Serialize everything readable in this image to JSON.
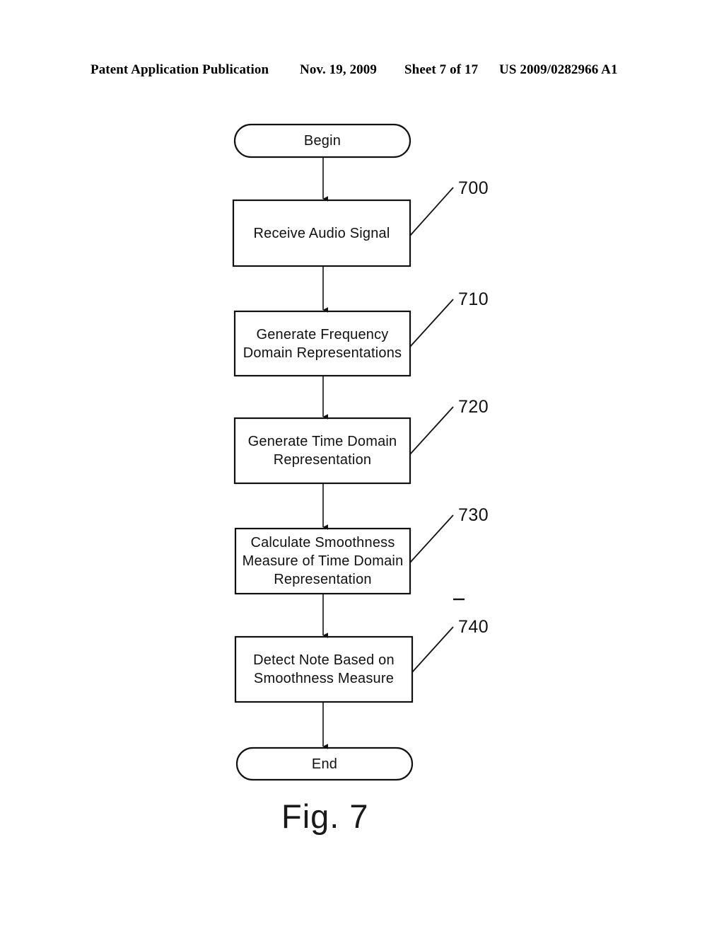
{
  "header": {
    "publication": "Patent Application Publication",
    "date": "Nov. 19, 2009",
    "sheet": "Sheet 7 of 17",
    "document_number": "US 2009/0282966 A1"
  },
  "figure": {
    "caption": "Fig. 7",
    "stroke_color": "#000000",
    "fill_color": "#ffffff"
  },
  "flowchart": {
    "nodes": [
      {
        "id": "begin",
        "shape": "terminal",
        "lines": [
          "Begin"
        ],
        "ref": null
      },
      {
        "id": "receive-audio-signal",
        "shape": "process",
        "lines": [
          "Receive Audio Signal"
        ],
        "ref": "700"
      },
      {
        "id": "generate-frequency-domain-representations",
        "shape": "process",
        "lines": [
          "Generate Frequency",
          "Domain Representations"
        ],
        "ref": "710"
      },
      {
        "id": "generate-time-domain-representation",
        "shape": "process",
        "lines": [
          "Generate Time Domain",
          "Representation"
        ],
        "ref": "720"
      },
      {
        "id": "calculate-smoothness-measure",
        "shape": "process",
        "lines": [
          "Calculate Smoothness",
          "Measure of Time Domain",
          "Representation"
        ],
        "ref": "730"
      },
      {
        "id": "detect-note",
        "shape": "process",
        "lines": [
          "Detect Note Based on",
          "Smoothness Measure"
        ],
        "ref": "740"
      },
      {
        "id": "end",
        "shape": "terminal",
        "lines": [
          "End"
        ],
        "ref": null
      }
    ],
    "reference_numerals": [
      "700",
      "710",
      "720",
      "730",
      "740"
    ],
    "connectors": 6
  }
}
